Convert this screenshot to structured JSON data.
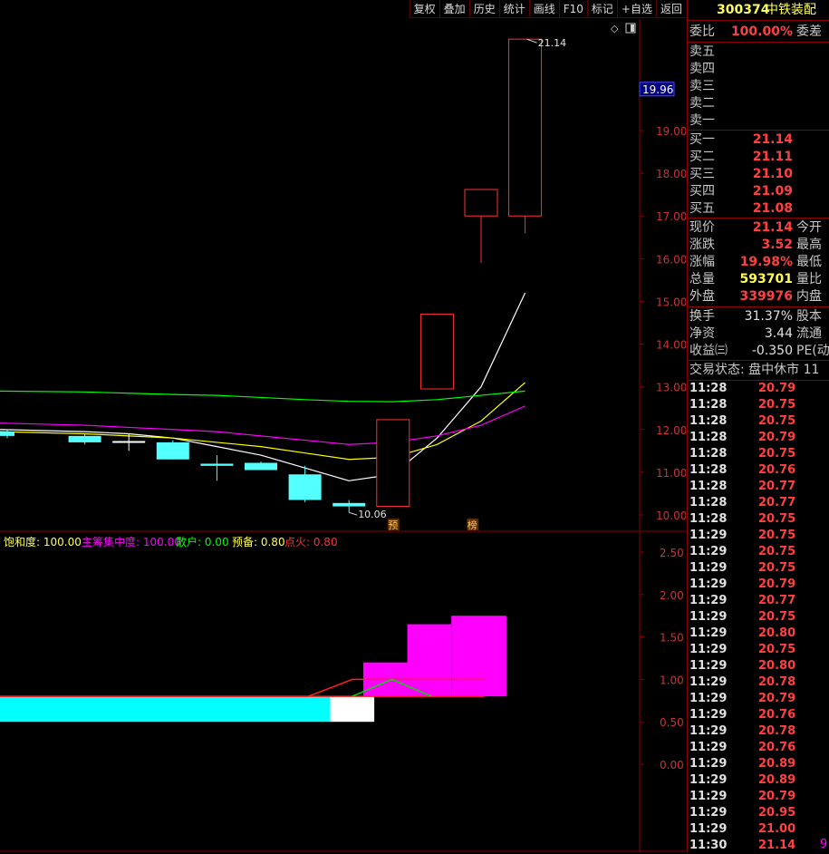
{
  "toolbar": {
    "buttons": [
      "复权",
      "叠加",
      "历史",
      "统计",
      "画线",
      "F10",
      "标记",
      "+自选",
      "返回"
    ]
  },
  "kline": {
    "price_axis_ticks": [
      "19.00",
      "18.00",
      "17.00",
      "16.00",
      "15.00",
      "14.00",
      "13.00",
      "12.00",
      "11.00",
      "10.00"
    ],
    "current_price_tag": "19.96",
    "high_label": "21.14",
    "low_label": "10.06",
    "markers": [
      "预",
      "榜"
    ]
  },
  "chart_data": [
    {
      "type": "candlestick",
      "title": "",
      "ylim": [
        9.8,
        22.2
      ],
      "candles": [
        {
          "open": 11.95,
          "close": 11.85,
          "high": 12.0,
          "low": 11.8,
          "color": "cyan"
        },
        {
          "open": 11.85,
          "close": 11.7,
          "high": 11.9,
          "low": 11.65,
          "color": "cyan"
        },
        {
          "open": 11.73,
          "close": 11.72,
          "high": 11.9,
          "low": 11.5,
          "color": "white"
        },
        {
          "open": 11.7,
          "close": 11.3,
          "high": 11.75,
          "low": 11.3,
          "color": "cyan"
        },
        {
          "open": 11.2,
          "close": 11.15,
          "high": 11.4,
          "low": 10.8,
          "color": "cyan"
        },
        {
          "open": 11.22,
          "close": 11.05,
          "high": 11.25,
          "low": 11.05,
          "color": "cyan"
        },
        {
          "open": 10.95,
          "close": 10.35,
          "high": 11.15,
          "low": 10.3,
          "color": "cyan"
        },
        {
          "open": 10.28,
          "close": 10.2,
          "high": 10.35,
          "low": 10.06,
          "color": "cyan"
        },
        {
          "open": 10.2,
          "close": 12.23,
          "high": 12.23,
          "low": 10.2,
          "color": "red"
        },
        {
          "open": 12.95,
          "close": 14.7,
          "high": 14.7,
          "low": 12.95,
          "color": "red"
        },
        {
          "open": 17.0,
          "close": 17.62,
          "high": 17.62,
          "low": 15.9,
          "color": "red"
        },
        {
          "open": 17.0,
          "close": 21.14,
          "high": 21.14,
          "low": 16.6,
          "color": "red"
        }
      ],
      "ma_lines": [
        {
          "color": "#ffffff",
          "values": [
            12.0,
            11.95,
            11.9,
            11.8,
            11.6,
            11.4,
            11.1,
            10.8,
            10.95,
            11.8,
            13.0,
            15.2
          ]
        },
        {
          "color": "#ffff00",
          "values": [
            11.95,
            11.9,
            11.85,
            11.8,
            11.7,
            11.6,
            11.45,
            11.3,
            11.35,
            11.65,
            12.2,
            13.1
          ]
        },
        {
          "color": "#ff00ff",
          "values": [
            12.15,
            12.1,
            12.05,
            12.0,
            11.95,
            11.85,
            11.75,
            11.65,
            11.7,
            11.85,
            12.1,
            12.55
          ]
        },
        {
          "color": "#00ff00",
          "values": [
            12.9,
            12.88,
            12.85,
            12.82,
            12.8,
            12.75,
            12.7,
            12.66,
            12.65,
            12.7,
            12.8,
            12.9
          ]
        }
      ]
    },
    {
      "type": "bar",
      "title": "",
      "ylim": [
        -0.6,
        2.6
      ],
      "axis_ticks": [
        "2.50",
        "2.00",
        "1.50",
        "1.00",
        "0.50",
        "0.00"
      ],
      "legend": [
        {
          "text": "饱和度: 100.00",
          "color": "#ffff55"
        },
        {
          "text": "主筹集中度: 100.00",
          "color": "#ff00ff"
        },
        {
          "text": "散户: 0.00",
          "color": "#00ff00"
        },
        {
          "text": "预备: 0.80",
          "color": "#ffff55"
        },
        {
          "text": "点火: 0.80",
          "color": "#ff3030"
        }
      ],
      "blocks": [
        {
          "color": "#00ffff",
          "from": 0,
          "to": 7.5,
          "bottom": 0.5,
          "top": 0.8
        },
        {
          "color": "#ffffff",
          "from": 7.5,
          "to": 8.5,
          "bottom": 0.5,
          "top": 0.8
        },
        {
          "color": "#ff00ff",
          "from": 8.25,
          "to": 9.25,
          "bottom": 0.8,
          "top": 1.2
        },
        {
          "color": "#ff00ff",
          "from": 9.25,
          "to": 10.25,
          "bottom": 0.8,
          "top": 1.65
        },
        {
          "color": "#ff00ff",
          "from": 10.25,
          "to": 11.5,
          "bottom": 0.8,
          "top": 1.75
        }
      ],
      "lines": [
        {
          "color": "#ff2020",
          "points": [
            [
              0,
              0.8
            ],
            [
              7,
              0.8
            ],
            [
              8,
              1.0
            ],
            [
              11,
              1.0
            ]
          ]
        },
        {
          "color": "#ff2020",
          "points": [
            [
              0,
              0.8
            ],
            [
              11,
              0.8
            ]
          ]
        },
        {
          "color": "#00dd00",
          "points": [
            [
              8,
              0.8
            ],
            [
              8.9,
              1.0
            ],
            [
              9.8,
              0.8
            ]
          ]
        }
      ]
    }
  ],
  "quote": {
    "code": "300374",
    "name": "中铁装配",
    "weibi_label": "委比",
    "weibi_value": "100.00%",
    "weicha_label": "委差",
    "asks": [
      {
        "label": "卖五",
        "price": ""
      },
      {
        "label": "卖四",
        "price": ""
      },
      {
        "label": "卖三",
        "price": ""
      },
      {
        "label": "卖二",
        "price": ""
      },
      {
        "label": "卖一",
        "price": ""
      }
    ],
    "bids": [
      {
        "label": "买一",
        "price": "21.14"
      },
      {
        "label": "买二",
        "price": "21.11"
      },
      {
        "label": "买三",
        "price": "21.10"
      },
      {
        "label": "买四",
        "price": "21.09"
      },
      {
        "label": "买五",
        "price": "21.08"
      }
    ],
    "stats": [
      {
        "label": "现价",
        "value": "21.14",
        "color": "red",
        "right": "今开"
      },
      {
        "label": "涨跌",
        "value": "3.52",
        "color": "red",
        "right": "最高"
      },
      {
        "label": "涨幅",
        "value": "19.98%",
        "color": "red",
        "right": "最低"
      },
      {
        "label": "总量",
        "value": "593701",
        "color": "yellow",
        "right": "量比"
      },
      {
        "label": "外盘",
        "value": "339976",
        "color": "red",
        "right": "内盘"
      }
    ],
    "stats2": [
      {
        "label": "换手",
        "value": "31.37%",
        "right": "股本"
      },
      {
        "label": "净资",
        "value": "3.44",
        "right": "流通"
      },
      {
        "label": "收益㈢",
        "value": "-0.350",
        "right": "PE(动"
      }
    ],
    "trade_status": "交易状态: 盘中休市 11",
    "ticks": [
      {
        "time": "11:28",
        "price": "20.79"
      },
      {
        "time": "11:28",
        "price": "20.75"
      },
      {
        "time": "11:28",
        "price": "20.75"
      },
      {
        "time": "11:28",
        "price": "20.79"
      },
      {
        "time": "11:28",
        "price": "20.75"
      },
      {
        "time": "11:28",
        "price": "20.76"
      },
      {
        "time": "11:28",
        "price": "20.77"
      },
      {
        "time": "11:28",
        "price": "20.77"
      },
      {
        "time": "11:28",
        "price": "20.75"
      },
      {
        "time": "11:29",
        "price": "20.75"
      },
      {
        "time": "11:29",
        "price": "20.75"
      },
      {
        "time": "11:29",
        "price": "20.75"
      },
      {
        "time": "11:29",
        "price": "20.79"
      },
      {
        "time": "11:29",
        "price": "20.77"
      },
      {
        "time": "11:29",
        "price": "20.75"
      },
      {
        "time": "11:29",
        "price": "20.80"
      },
      {
        "time": "11:29",
        "price": "20.75"
      },
      {
        "time": "11:29",
        "price": "20.80"
      },
      {
        "time": "11:29",
        "price": "20.78"
      },
      {
        "time": "11:29",
        "price": "20.79"
      },
      {
        "time": "11:29",
        "price": "20.76"
      },
      {
        "time": "11:29",
        "price": "20.78"
      },
      {
        "time": "11:29",
        "price": "20.76"
      },
      {
        "time": "11:29",
        "price": "20.89"
      },
      {
        "time": "11:29",
        "price": "20.89"
      },
      {
        "time": "11:29",
        "price": "20.79"
      },
      {
        "time": "11:29",
        "price": "20.95"
      },
      {
        "time": "11:29",
        "price": "21.00"
      },
      {
        "time": "11:30",
        "price": "21.14"
      }
    ],
    "last_tick_vol": "9"
  }
}
